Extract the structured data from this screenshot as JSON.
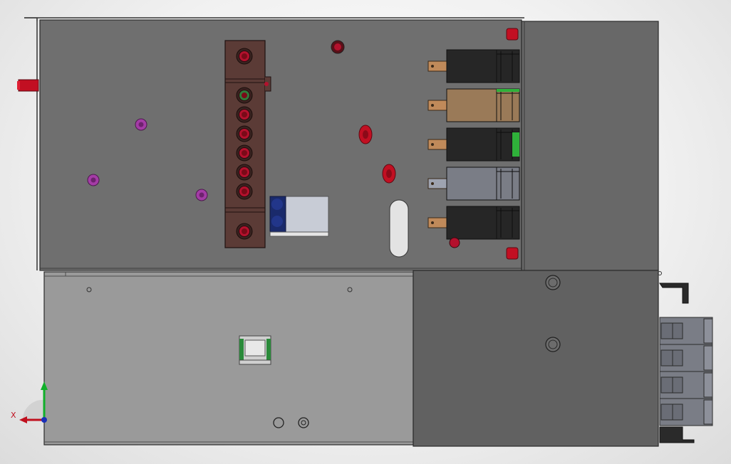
{
  "viewport": {
    "background_color": "#efefef",
    "model": {
      "upper_panel_color": "#6f6f6f",
      "lower_left_panel_color": "#9a9a9a",
      "lower_right_panel_color": "#616161",
      "terminal_block_color": "#5b3b36",
      "terminal_color": "#b3112d",
      "purple_fastener_color": "#a43ca6",
      "relays": [
        {
          "body_color": "#262626",
          "tab_color": "#c08a5a"
        },
        {
          "body_color": "#9a7a58",
          "tab_color": "#c08a5a"
        },
        {
          "body_color": "#262626",
          "tab_color": "#c08a5a",
          "indicator_color": "#2fb13a"
        },
        {
          "body_color": "#7a7d86",
          "tab_color": "#9ea3b0"
        },
        {
          "body_color": "#262626",
          "tab_color": "#c08a5a"
        }
      ]
    },
    "triad": {
      "x_label": "X",
      "x_color": "#c0101e",
      "y_color": "#10b02a",
      "z_color": "#1a2fb8"
    }
  }
}
